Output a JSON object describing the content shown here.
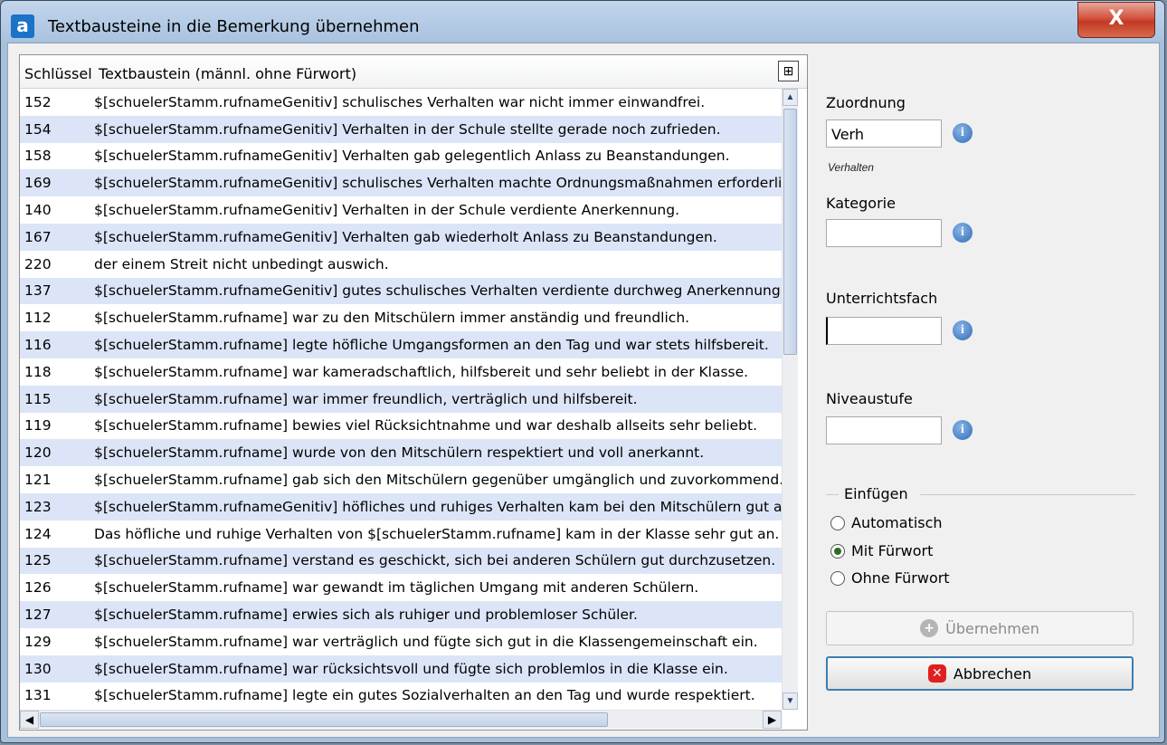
{
  "window": {
    "title": "Textbausteine in die Bemerkung übernehmen",
    "app_icon": "a",
    "close": "X"
  },
  "grid": {
    "columns": [
      "Schlüssel",
      "Textbaustein (männl. ohne Fürwort)"
    ],
    "col_chooser_icon": "column-chooser-icon",
    "rows": [
      {
        "key": "152",
        "text": "$[schuelerStamm.rufnameGenitiv] schulisches Verhalten war nicht immer einwandfrei."
      },
      {
        "key": "154",
        "text": "$[schuelerStamm.rufnameGenitiv] Verhalten in der Schule stellte gerade noch zufrieden."
      },
      {
        "key": "158",
        "text": "$[schuelerStamm.rufnameGenitiv] Verhalten gab gelegentlich Anlass zu Beanstandungen."
      },
      {
        "key": "169",
        "text": "$[schuelerStamm.rufnameGenitiv] schulisches Verhalten machte Ordnungsmaßnahmen erforderlich."
      },
      {
        "key": "140",
        "text": "$[schuelerStamm.rufnameGenitiv] Verhalten in der Schule verdiente Anerkennung."
      },
      {
        "key": "167",
        "text": "$[schuelerStamm.rufnameGenitiv] Verhalten gab wiederholt Anlass zu Beanstandungen."
      },
      {
        "key": "220",
        "text": "der einem Streit nicht unbedingt auswich."
      },
      {
        "key": "137",
        "text": "$[schuelerStamm.rufnameGenitiv] gutes schulisches Verhalten verdiente durchweg Anerkennung."
      },
      {
        "key": "112",
        "text": "$[schuelerStamm.rufname] war zu den Mitschülern immer anständig und freundlich."
      },
      {
        "key": "116",
        "text": "$[schuelerStamm.rufname] legte höfliche Umgangsformen an den Tag und war stets hilfsbereit."
      },
      {
        "key": "118",
        "text": "$[schuelerStamm.rufname] war kameradschaftlich, hilfsbereit und sehr beliebt in der Klasse."
      },
      {
        "key": "115",
        "text": "$[schuelerStamm.rufname] war immer freundlich, verträglich und hilfsbereit."
      },
      {
        "key": "119",
        "text": "$[schuelerStamm.rufname] bewies viel Rücksichtnahme und war deshalb allseits sehr beliebt."
      },
      {
        "key": "120",
        "text": "$[schuelerStamm.rufname] wurde von den Mitschülern respektiert und voll anerkannt."
      },
      {
        "key": "121",
        "text": "$[schuelerStamm.rufname] gab sich den Mitschülern gegenüber umgänglich und zuvorkommend."
      },
      {
        "key": "123",
        "text": "$[schuelerStamm.rufnameGenitiv] höfliches und ruhiges Verhalten kam bei den Mitschülern gut an."
      },
      {
        "key": "124",
        "text": "Das höfliche und ruhige Verhalten von $[schuelerStamm.rufname] kam in der Klasse sehr gut an."
      },
      {
        "key": "125",
        "text": "$[schuelerStamm.rufname] verstand es geschickt, sich bei anderen Schülern gut durchzusetzen."
      },
      {
        "key": "126",
        "text": "$[schuelerStamm.rufname] war gewandt im täglichen Umgang mit anderen Schülern."
      },
      {
        "key": "127",
        "text": "$[schuelerStamm.rufname] erwies sich als ruhiger und problemloser Schüler."
      },
      {
        "key": "129",
        "text": "$[schuelerStamm.rufname] war verträglich und fügte sich gut in die Klassengemeinschaft ein."
      },
      {
        "key": "130",
        "text": "$[schuelerStamm.rufname] war rücksichtsvoll und fügte sich problemlos in die Klasse ein."
      },
      {
        "key": "131",
        "text": "$[schuelerStamm.rufname] legte ein gutes Sozialverhalten an den Tag und wurde respektiert."
      }
    ]
  },
  "panel": {
    "zuordnung": {
      "label": "Zuordnung",
      "value": "Verh",
      "hint": "Verhalten"
    },
    "kategorie": {
      "label": "Kategorie",
      "value": ""
    },
    "unterrichtsfach": {
      "label": "Unterrichtsfach",
      "value": ""
    },
    "niveaustufe": {
      "label": "Niveaustufe",
      "value": ""
    },
    "info_icon": "i",
    "einfuegen": {
      "label": "Einfügen",
      "options": [
        "Automatisch",
        "Mit Fürwort",
        "Ohne Fürwort"
      ],
      "selected": "Mit Fürwort"
    },
    "buttons": {
      "apply": "Übernehmen",
      "cancel": "Abbrechen"
    }
  }
}
